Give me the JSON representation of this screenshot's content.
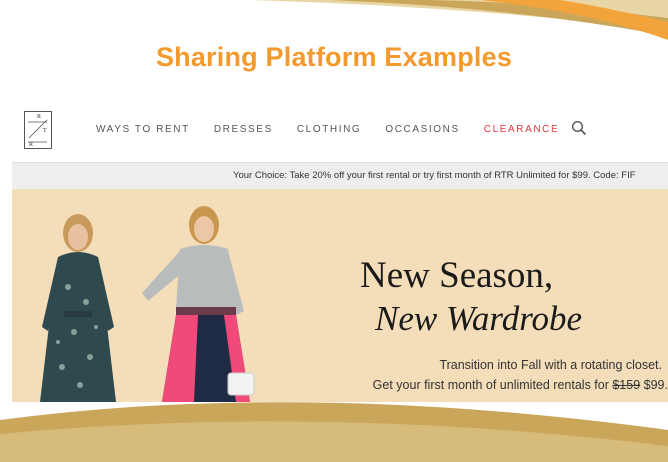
{
  "slide": {
    "title": "Sharing Platform Examples"
  },
  "colors": {
    "title": "#f29a2e",
    "swoosh_gold": "#c9a65a",
    "swoosh_orange": "#f2a43a",
    "hero_bg": "#f4deb9",
    "clearance": "#e0393e"
  },
  "logo": {
    "letters": [
      "R",
      "T",
      "R"
    ]
  },
  "nav": {
    "items": [
      {
        "label": "WAYS TO RENT"
      },
      {
        "label": "DRESSES"
      },
      {
        "label": "CLOTHING"
      },
      {
        "label": "OCCASIONS"
      },
      {
        "label": "CLEARANCE"
      }
    ],
    "search_icon": "search-icon"
  },
  "promo": {
    "text": "Your Choice: Take 20% off your first rental or try first month of RTR Unlimited for $99. Code: FIF"
  },
  "hero": {
    "headline_1": "New Season,",
    "headline_2": "New Wardrobe",
    "sub_line_1": "Transition into Fall with a rotating closet.",
    "sub_line_2_a": "Get your first month of unlimited rentals for ",
    "old_price": "$159",
    "new_price": "$99."
  }
}
